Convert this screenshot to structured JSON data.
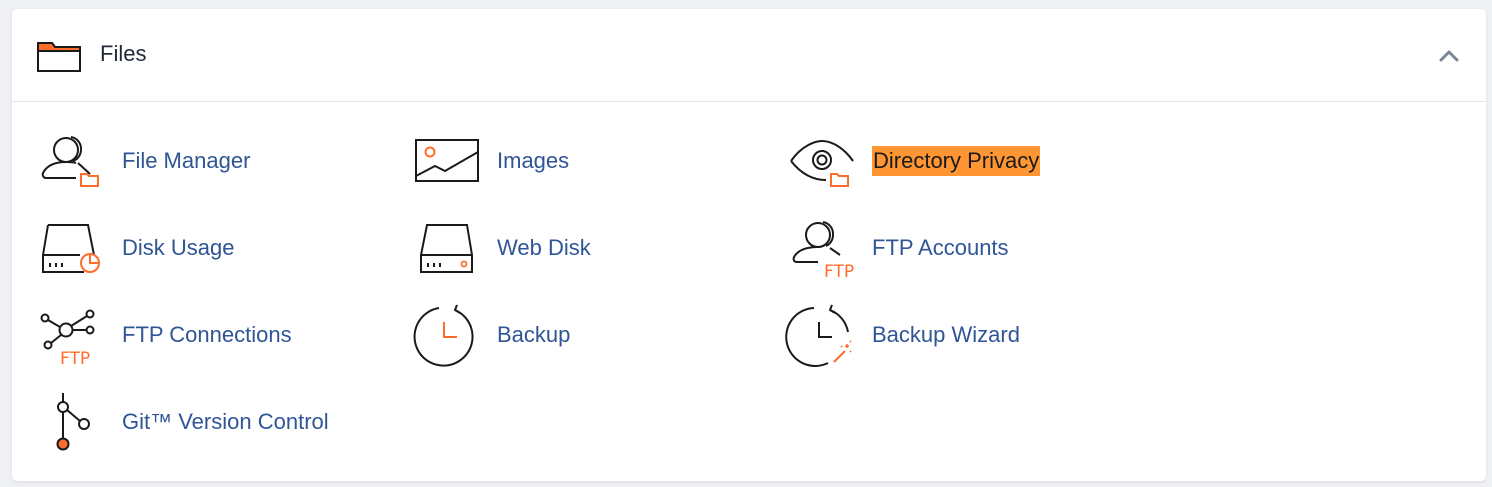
{
  "panel": {
    "title": "Files",
    "collapse_icon": "chevron-up-icon",
    "folder_icon": "folder-icon"
  },
  "colors": {
    "accent": "#ff6c2c",
    "link": "#2f5597",
    "highlight": "#ff9633",
    "icon_stroke": "#1a1a1a"
  },
  "items": [
    {
      "label": "File Manager",
      "icon": "file-manager-icon"
    },
    {
      "label": "Images",
      "icon": "images-icon"
    },
    {
      "label": "Directory Privacy",
      "icon": "directory-privacy-icon",
      "highlighted": true
    },
    {
      "label": "Disk Usage",
      "icon": "disk-usage-icon"
    },
    {
      "label": "Web Disk",
      "icon": "web-disk-icon"
    },
    {
      "label": "FTP Accounts",
      "icon": "ftp-accounts-icon"
    },
    {
      "label": "FTP Connections",
      "icon": "ftp-connections-icon"
    },
    {
      "label": "Backup",
      "icon": "backup-icon"
    },
    {
      "label": "Backup Wizard",
      "icon": "backup-wizard-icon"
    },
    {
      "label": "Git™ Version Control",
      "icon": "git-version-control-icon"
    }
  ],
  "ftp_text": "FTP"
}
